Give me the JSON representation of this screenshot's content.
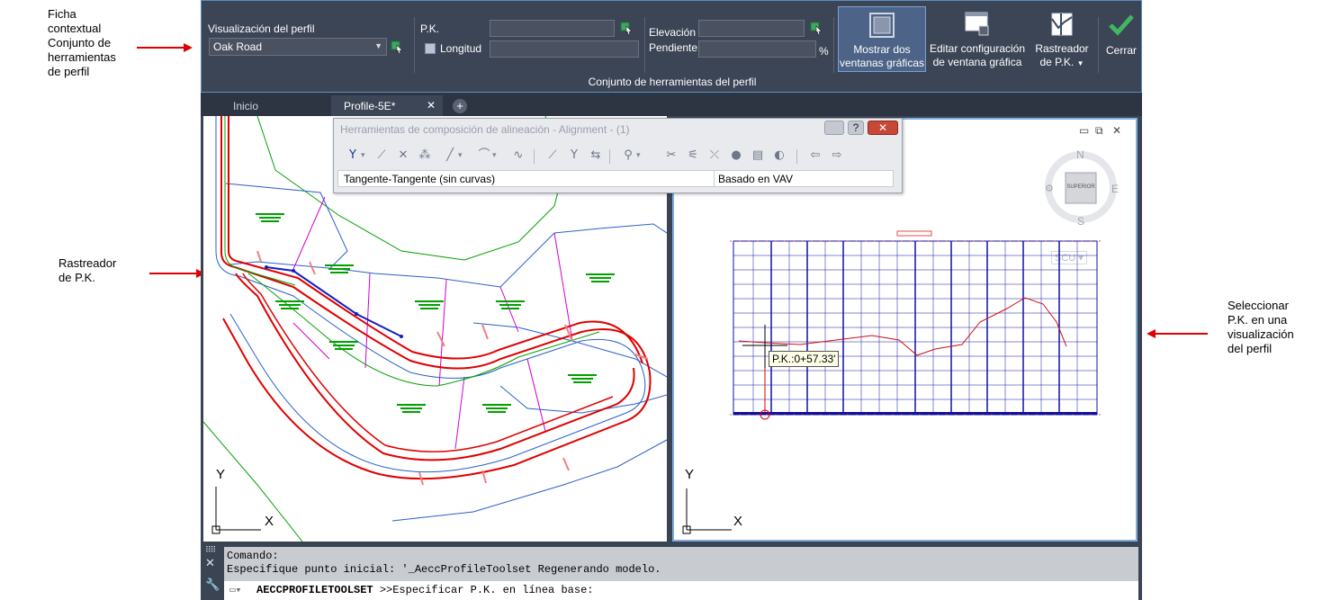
{
  "callouts": {
    "ficha": [
      "Ficha",
      "contextual",
      "Conjunto de",
      "herramientas",
      "de perfil"
    ],
    "rastreador": [
      "Rastreador",
      "de P.K."
    ],
    "seleccionar": [
      "Seleccionar",
      "P.K. en una",
      "visualización",
      "del perfil"
    ]
  },
  "ribbon": {
    "profile_view_label": "Visualización del perfil",
    "profile_view_value": "Oak Road",
    "pk_label": "P.K.",
    "length_label": "Longitud",
    "elevation_label": "Elevación",
    "slope_label": "Pendiente",
    "percent": "%",
    "show_two_views": [
      "Mostrar dos",
      "ventanas gráficas"
    ],
    "edit_config": [
      "Editar configuración",
      "de ventana gráfica"
    ],
    "tracker": [
      "Rastreador",
      "de P.K."
    ],
    "close": "Cerrar",
    "panel_title": "Conjunto de herramientas del perfil"
  },
  "tabs": [
    {
      "label": "Inicio",
      "active": false
    },
    {
      "label": "Profile-5E*",
      "active": true
    }
  ],
  "alignment_toolbar": {
    "title": "Herramientas de composición de alineación - Alignment - (1)",
    "status_left": "Tangente-Tangente (sin curvas)",
    "status_right": "Basado en VAV"
  },
  "right_view": {
    "compass": {
      "north": "N",
      "south": "S",
      "east": "E"
    },
    "cube_face": "SUPERIOR",
    "scu": "SCU",
    "tooltip": "P.K.:0+57.33'"
  },
  "ucs": {
    "x": "X",
    "y": "Y"
  },
  "command": {
    "line1": "Comando:",
    "line2": "Especifique punto inicial: '_AeccProfileToolset Regenerando modelo.",
    "prompt_bold": "AECCPROFILETOOLSET",
    "prompt_rest": " >>Especificar P.K. en línea base:"
  },
  "colors": {
    "ribbon_bg": "#3c4556",
    "accent": "#5b8ec0",
    "alignment_red": "#e00000",
    "parcel_green": "#00a000",
    "profile_grid_blue": "#1010a0"
  }
}
